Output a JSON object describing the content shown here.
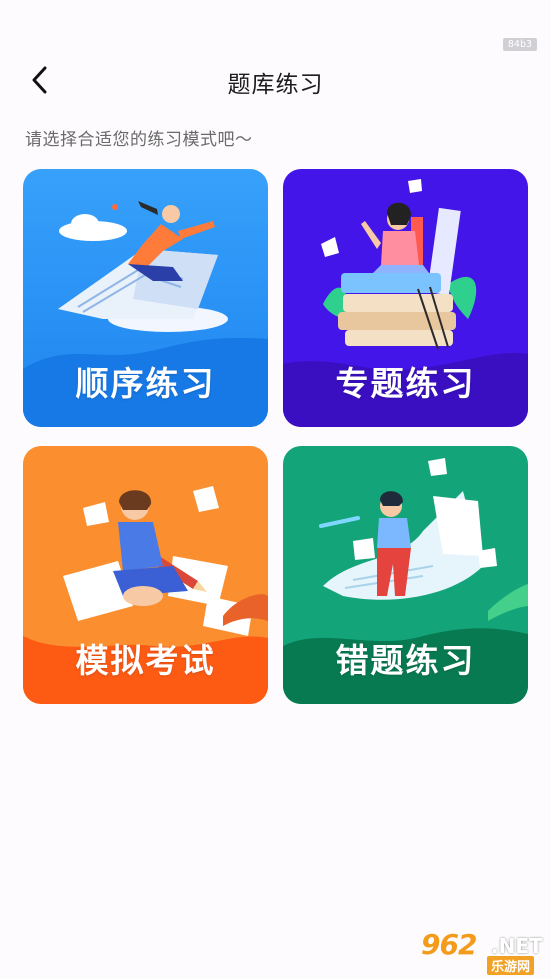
{
  "debug_tag": "84b3",
  "header": {
    "title": "题库练习"
  },
  "subtitle": "请选择合适您的练习模式吧～",
  "cards": [
    {
      "label": "顺序练习",
      "color": "#2f8ff5"
    },
    {
      "label": "专题练习",
      "color": "#4316e6"
    },
    {
      "label": "模拟考试",
      "color": "#fb7a1c"
    },
    {
      "label": "错题练习",
      "color": "#0ea07a"
    }
  ],
  "watermark": {
    "brand_number": "962",
    "brand_net": ".NET",
    "brand_cn": "乐游网"
  }
}
